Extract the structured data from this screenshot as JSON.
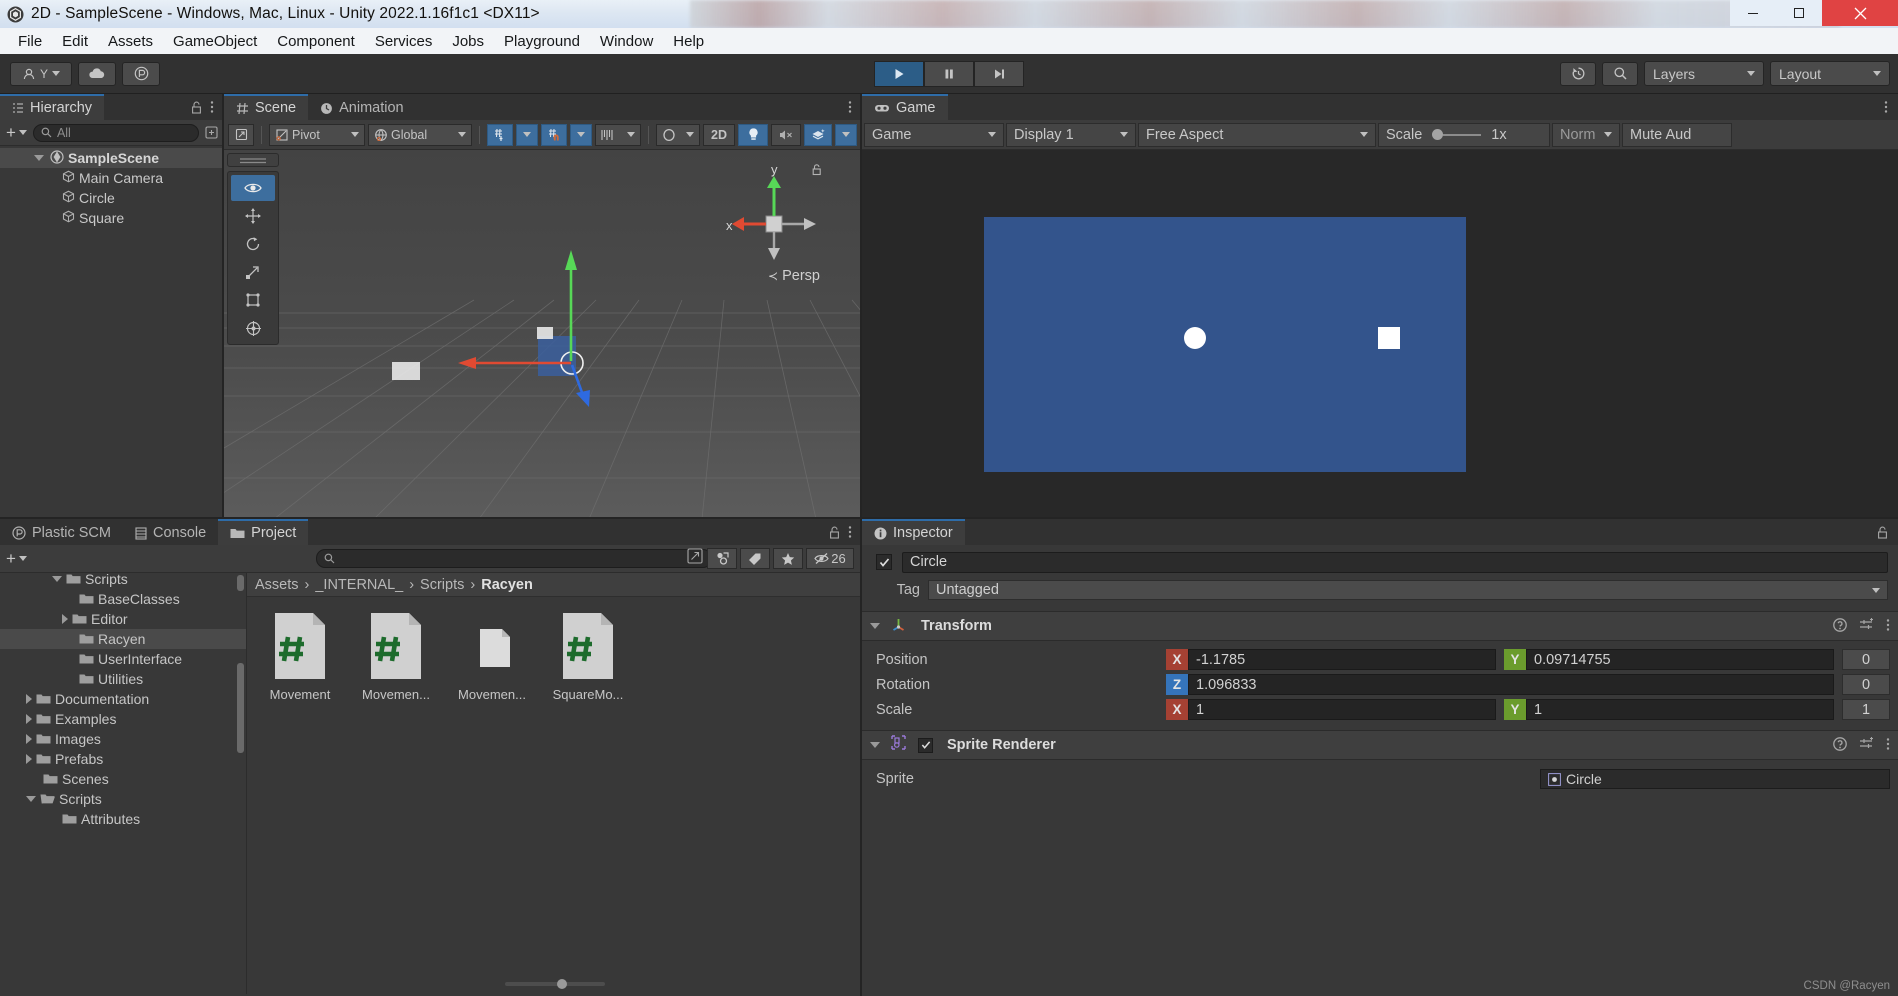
{
  "window": {
    "title": "2D - SampleScene - Windows, Mac, Linux - Unity 2022.1.16f1c1 <DX11>",
    "minimize": "—",
    "maximize": "❐",
    "close": "✕"
  },
  "menubar": {
    "items": [
      "File",
      "Edit",
      "Assets",
      "GameObject",
      "Component",
      "Services",
      "Jobs",
      "Playground",
      "Window",
      "Help"
    ]
  },
  "toolbar": {
    "account_label": "Y",
    "cloud_icon": "cloud-icon",
    "collab_icon": "plastic-scm-icon",
    "play_icon": "▶",
    "pause_icon": "‖",
    "step_icon": "▶|",
    "undo_history_icon": "↺",
    "search_icon": "⚲",
    "layers_label": "Layers",
    "layout_label": "Layout"
  },
  "hierarchy": {
    "tab": "Hierarchy",
    "tab_icon": "hierarchy-icon",
    "add_label": "+",
    "search_placeholder": "All",
    "items": [
      {
        "label": "SampleScene",
        "depth": 0,
        "icon": "scene-icon",
        "expanded": true,
        "selected": true
      },
      {
        "label": "Main Camera",
        "depth": 1,
        "icon": "gameobject-icon",
        "expanded": false,
        "selected": false
      },
      {
        "label": "Circle",
        "depth": 1,
        "icon": "gameobject-icon",
        "expanded": false,
        "selected": false
      },
      {
        "label": "Square",
        "depth": 1,
        "icon": "gameobject-icon",
        "expanded": false,
        "selected": false
      }
    ]
  },
  "scene": {
    "tabs": [
      {
        "label": "Scene",
        "icon": "grid-icon",
        "active": true
      },
      {
        "label": "Animation",
        "icon": "clock-icon",
        "active": false
      }
    ],
    "toolbar": {
      "pivot_label": "Pivot",
      "global_label": "Global",
      "twod_label": "2D",
      "grid_icon": "grid-snap-icon",
      "magnet_icon": "magnet-snap-icon",
      "ruler_icon": "ruler-icon",
      "gizmo_icon": "lighting-sphere-icon",
      "light_icon": "light-bulb-icon",
      "audio_icon": "audio-mute-icon",
      "fx_icon": "effects-icon"
    },
    "tools": [
      "view-tool",
      "move-tool",
      "rotate-tool",
      "scale-tool",
      "rect-tool",
      "transform-tool"
    ],
    "active_tool_index": 0,
    "gizmo": {
      "x_label": "x",
      "y_label": "y",
      "persp_label": "Persp"
    }
  },
  "game": {
    "tab": "Game",
    "tab_icon": "gamepad-icon",
    "view_selector": "Game",
    "display": "Display 1",
    "aspect": "Free Aspect",
    "scale_label": "Scale",
    "scale_value": "1x",
    "vsync_label": "Norma",
    "mute_label": "Mute Aud",
    "render_bg_color": "#33548c",
    "objects": [
      {
        "name": "circle-sprite",
        "shape": "circle",
        "color": "#ffffff"
      },
      {
        "name": "square-sprite",
        "shape": "square",
        "color": "#ffffff"
      }
    ]
  },
  "project": {
    "tabs": [
      {
        "label": "Plastic SCM",
        "icon": "plastic-icon",
        "active": false
      },
      {
        "label": "Console",
        "icon": "console-icon",
        "active": false
      },
      {
        "label": "Project",
        "icon": "folder-icon",
        "active": true
      }
    ],
    "add_label": "+",
    "search_placeholder": "",
    "hidden_count": "26",
    "breadcrumb": [
      "Assets",
      "_INTERNAL_",
      "Scripts",
      "Racyen"
    ],
    "tree": [
      {
        "label": "Scripts",
        "depth": 2,
        "arrow": "down",
        "selected": false,
        "partial": true
      },
      {
        "label": "BaseClasses",
        "depth": 3,
        "arrow": "none",
        "selected": false
      },
      {
        "label": "Editor",
        "depth": 3,
        "arrow": "right",
        "selected": false
      },
      {
        "label": "Racyen",
        "depth": 3,
        "arrow": "none",
        "selected": true
      },
      {
        "label": "UserInterface",
        "depth": 3,
        "arrow": "none",
        "selected": false
      },
      {
        "label": "Utilities",
        "depth": 3,
        "arrow": "none",
        "selected": false
      },
      {
        "label": "Documentation",
        "depth": 1,
        "arrow": "right",
        "selected": false
      },
      {
        "label": "Examples",
        "depth": 1,
        "arrow": "right",
        "selected": false
      },
      {
        "label": "Images",
        "depth": 1,
        "arrow": "right",
        "selected": false
      },
      {
        "label": "Prefabs",
        "depth": 1,
        "arrow": "right",
        "selected": false
      },
      {
        "label": "Scenes",
        "depth": 1,
        "arrow": "none",
        "selected": false
      },
      {
        "label": "Scripts",
        "depth": 1,
        "arrow": "down",
        "selected": false,
        "open": true
      },
      {
        "label": "Attributes",
        "depth": 2,
        "arrow": "none",
        "selected": false
      }
    ],
    "assets": [
      {
        "label": "Movement",
        "type": "csharp"
      },
      {
        "label": "Movemen...",
        "type": "csharp"
      },
      {
        "label": "Movemen...",
        "type": "file"
      },
      {
        "label": "SquareMo...",
        "type": "csharp"
      }
    ]
  },
  "inspector": {
    "tab": "Inspector",
    "tab_icon": "info-icon",
    "enabled": true,
    "object_name": "Circle",
    "tag_label": "Tag",
    "tag_value": "Untagged",
    "components": [
      {
        "name": "Transform",
        "icon": "transform-icon",
        "has_checkbox": false,
        "rows": [
          {
            "label": "Position",
            "fields": [
              {
                "axis": "X",
                "value": "-1.1785",
                "readonly": false
              },
              {
                "axis": "Y",
                "value": "0.09714755",
                "readonly": false
              },
              {
                "axis": "",
                "value": "0",
                "readonly": true
              }
            ]
          },
          {
            "label": "Rotation",
            "fields": [
              {
                "axis": "Z",
                "value": "1.096833",
                "readonly": false,
                "span": 2
              },
              {
                "axis": "",
                "value": "0",
                "readonly": true
              }
            ]
          },
          {
            "label": "Scale",
            "fields": [
              {
                "axis": "X",
                "value": "1",
                "readonly": false
              },
              {
                "axis": "Y",
                "value": "1",
                "readonly": false
              },
              {
                "axis": "",
                "value": "1",
                "readonly": true
              }
            ]
          }
        ]
      },
      {
        "name": "Sprite Renderer",
        "icon": "sprite-renderer-icon",
        "has_checkbox": true,
        "checked": true,
        "rows": [
          {
            "label": "Sprite",
            "value": "Circle"
          }
        ]
      }
    ]
  },
  "watermark": "CSDN @Racyen",
  "colors": {
    "accent_blue": "#3d6e9e",
    "panel_bg": "#383838",
    "toolbar_bg": "#3c3c3c",
    "axis_x": "#a54133",
    "axis_y": "#6b9c2d",
    "axis_z": "#3574ba"
  }
}
